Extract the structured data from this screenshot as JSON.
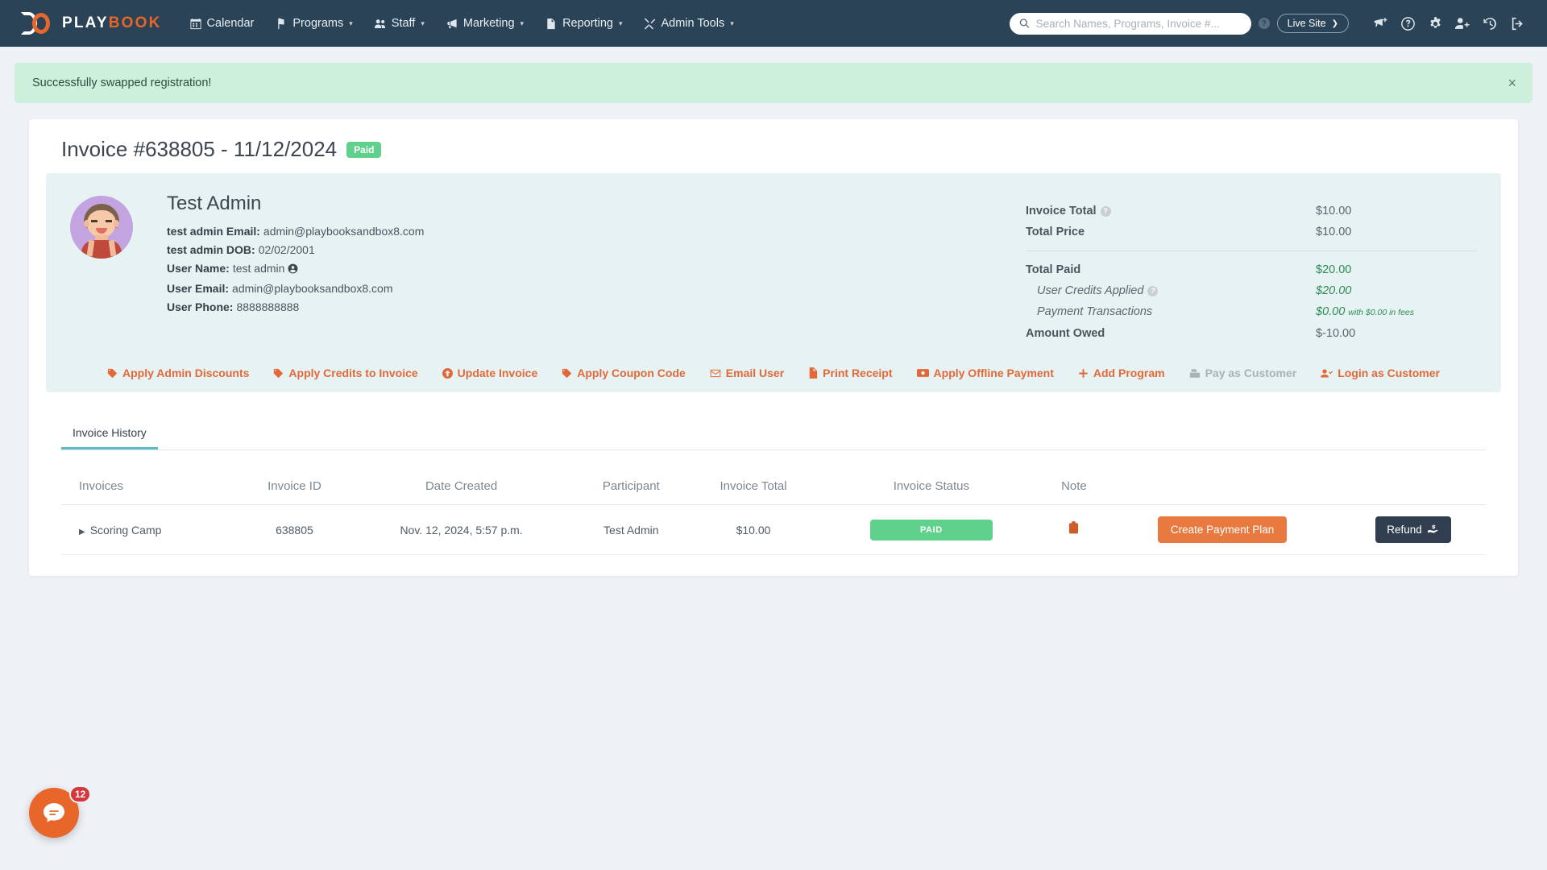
{
  "brand": {
    "word1": "PLAY",
    "word2": "BOOK"
  },
  "nav": {
    "links": [
      {
        "label": "Calendar",
        "icon": "calendar-icon",
        "caret": false
      },
      {
        "label": "Programs",
        "icon": "flag-icon",
        "caret": true
      },
      {
        "label": "Staff",
        "icon": "users-icon",
        "caret": true
      },
      {
        "label": "Marketing",
        "icon": "megaphone-icon",
        "caret": true
      },
      {
        "label": "Reporting",
        "icon": "document-icon",
        "caret": true
      },
      {
        "label": "Admin Tools",
        "icon": "tools-icon",
        "caret": true
      }
    ],
    "search": {
      "placeholder": "Search Names, Programs, Invoice #...",
      "value": ""
    },
    "help_badge": "?",
    "live_site": {
      "label": "Live Site",
      "arrow": "❯"
    },
    "right_icons": [
      "announcement-add-icon",
      "help-circle-icon",
      "gear-icon",
      "add-user-icon",
      "history-icon",
      "logout-icon"
    ]
  },
  "alert": {
    "message": "Successfully swapped registration!",
    "close": "×"
  },
  "page": {
    "title": "Invoice #638805 - 11/12/2024",
    "status_badge": "Paid"
  },
  "person": {
    "name": "Test Admin",
    "rows": [
      {
        "label": "test admin Email:",
        "value": "admin@playbooksandbox8.com",
        "icon": ""
      },
      {
        "label": "test admin DOB:",
        "value": "02/02/2001",
        "icon": ""
      },
      {
        "label": "User Name:",
        "value": "test admin",
        "icon": "person-circle-icon"
      },
      {
        "label": "User Email:",
        "value": "admin@playbooksandbox8.com",
        "icon": ""
      },
      {
        "label": "User Phone:",
        "value": "8888888888",
        "icon": ""
      }
    ]
  },
  "totals": {
    "invoice_total": {
      "label": "Invoice Total",
      "value": "$10.00",
      "help": "?"
    },
    "total_price": {
      "label": "Total Price",
      "value": "$10.00"
    },
    "total_paid": {
      "label": "Total Paid",
      "value": "$20.00"
    },
    "user_credits": {
      "label": "User Credits Applied",
      "value": "$20.00",
      "help": "?"
    },
    "payment_transactions": {
      "label": "Payment Transactions",
      "value": "$0.00",
      "fee_note": "with $0.00 in fees"
    },
    "amount_owed": {
      "label": "Amount Owed",
      "value": "$-10.00"
    }
  },
  "actions": [
    {
      "label": "Apply Admin Discounts",
      "icon": "tag-icon",
      "disabled": false
    },
    {
      "label": "Apply Credits to Invoice",
      "icon": "tag-icon",
      "disabled": false
    },
    {
      "label": "Update Invoice",
      "icon": "arrow-up-circle-icon",
      "disabled": false
    },
    {
      "label": "Apply Coupon Code",
      "icon": "tag-icon",
      "disabled": false
    },
    {
      "label": "Email User",
      "icon": "envelope-icon",
      "disabled": false
    },
    {
      "label": "Print Receipt",
      "icon": "file-icon",
      "disabled": false
    },
    {
      "label": "Apply Offline Payment",
      "icon": "cash-icon",
      "disabled": false
    },
    {
      "label": "Add Program",
      "icon": "plus-icon",
      "disabled": false
    },
    {
      "label": "Pay as Customer",
      "icon": "register-icon",
      "disabled": true
    },
    {
      "label": "Login as Customer",
      "icon": "user-check-icon",
      "disabled": false
    }
  ],
  "tabs": [
    {
      "label": "Invoice History",
      "active": true
    }
  ],
  "table": {
    "headers": [
      "Invoices",
      "Invoice ID",
      "Date Created",
      "Participant",
      "Invoice Total",
      "Invoice Status",
      "Note",
      "",
      ""
    ],
    "rows": [
      {
        "invoice": "Scoring Camp",
        "invoice_id": "638805",
        "date_created": "Nov. 12, 2024, 5:57 p.m.",
        "participant": "Test Admin",
        "invoice_total": "$10.00",
        "invoice_status": "PAID",
        "note_icon": "clipboard-icon",
        "payment_plan_label": "Create Payment Plan",
        "refund_label": "Refund"
      }
    ]
  },
  "chat": {
    "badge": "12",
    "icon": "chat-icon"
  },
  "colors": {
    "navy": "#2a4356",
    "orange": "#e8662a",
    "green": "#5fd18c",
    "panel": "#e6f3f2",
    "teal": "#5bb9c4"
  }
}
